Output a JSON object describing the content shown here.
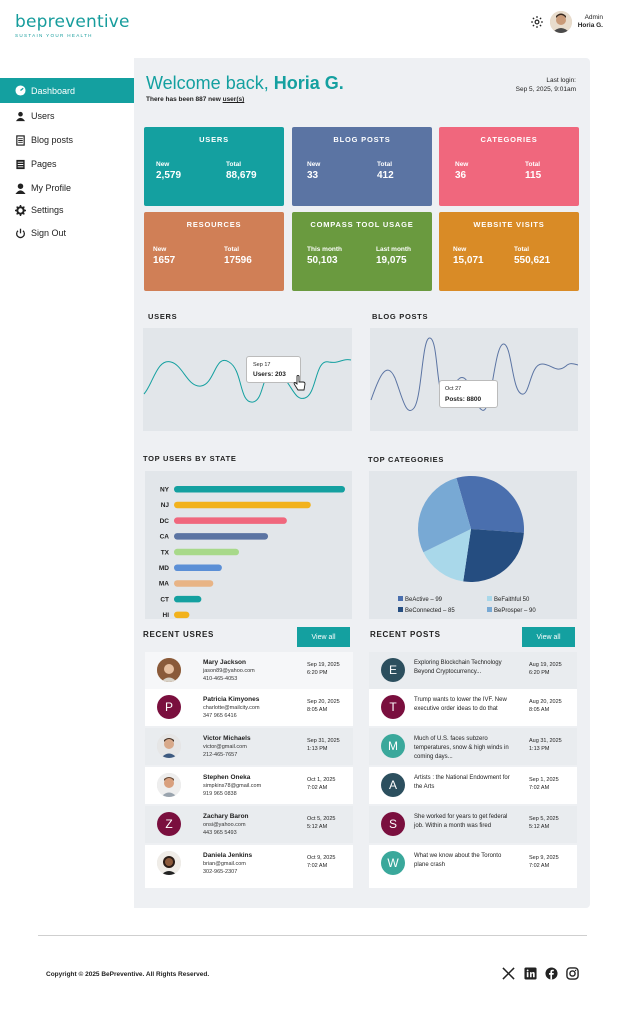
{
  "brand": {
    "name": "bepreventive",
    "tagline": "SUSTAIN YOUR HEALTH",
    "color": "#169c9c"
  },
  "header": {
    "admin_role": "Admin",
    "admin_name": "Horia G."
  },
  "sidebar": {
    "items": [
      {
        "label": "Dashboard",
        "icon": "dashboard-icon",
        "active": true
      },
      {
        "label": "Users",
        "icon": "users-icon"
      },
      {
        "label": "Blog posts",
        "icon": "blog-icon"
      },
      {
        "label": "Pages",
        "icon": "pages-icon"
      },
      {
        "label": "My Profile",
        "icon": "profile-icon"
      },
      {
        "label": "Settings",
        "icon": "gear-icon"
      },
      {
        "label": "Sign Out",
        "icon": "power-icon"
      }
    ]
  },
  "welcome": {
    "greeting": "Welcome back, ",
    "name": "Horia G.",
    "new_users_prefix": "There has been 887 new ",
    "new_users_link": "user(s)",
    "last_login_label": "Last login:",
    "last_login_value": "Sep 5, 2025, 9:01am"
  },
  "stats": [
    {
      "title": "USERS",
      "l1": "New",
      "v1": "2,579",
      "l2": "Total",
      "v2": "88,679",
      "color": "#14a0a0"
    },
    {
      "title": "BLOG POSTS",
      "l1": "New",
      "v1": "33",
      "l2": "Total",
      "v2": "412",
      "color": "#5b74a3"
    },
    {
      "title": "CATEGORIES",
      "l1": "New",
      "v1": "36",
      "l2": "Total",
      "v2": "115",
      "color": "#f0677d"
    },
    {
      "title": "RESOURCES",
      "l1": "New",
      "v1": "1657",
      "l2": "Total",
      "v2": "17596",
      "color": "#d07f56"
    },
    {
      "title": "COMPASS TOOL USAGE",
      "l1": "This month",
      "v1": "50,103",
      "l2": "Last month",
      "v2": "19,075",
      "color": "#6a9a3f"
    },
    {
      "title": "WEBSITE VISITS",
      "l1": "New",
      "v1": "15,071",
      "l2": "Total",
      "v2": "550,621",
      "color": "#d98b26"
    }
  ],
  "charts": {
    "users_title": "USERS",
    "users_tooltip_date": "Sep 17",
    "users_tooltip_value": "Users: 203",
    "blog_title": "BLOG POSTS",
    "blog_tooltip_date": "Oct 27",
    "blog_tooltip_value": "Posts: 8800",
    "states_title": "TOP USERS BY STATE",
    "categories_title": "TOP CATEGORIES"
  },
  "chart_data": [
    {
      "type": "bar",
      "title": "TOP USERS BY STATE",
      "orientation": "horizontal",
      "categories": [
        "NY",
        "NJ",
        "DC",
        "CA",
        "TX",
        "MD",
        "MA",
        "CT",
        "HI"
      ],
      "values": [
        100,
        80,
        66,
        55,
        38,
        28,
        23,
        16,
        9
      ],
      "colors": [
        "#14a0a0",
        "#f2b21c",
        "#f0677d",
        "#5b74a3",
        "#a8d98a",
        "#5b8fd6",
        "#e8b486",
        "#14a0a0",
        "#f2b21c"
      ]
    },
    {
      "type": "pie",
      "title": "TOP CATEGORIES",
      "labels": [
        "BeActive – 99",
        "BeFaithful   50",
        "BeConnected – 85",
        "BeProsper – 90"
      ],
      "values": [
        99,
        50,
        85,
        90
      ],
      "colors": [
        "#4a6fae",
        "#a9d8ea",
        "#254d80",
        "#78a9d4"
      ]
    }
  ],
  "recent_users": {
    "title": "RECENT USRES",
    "view_all": "View all",
    "rows": [
      {
        "initial": "",
        "avatar": "photo",
        "name": "Mary Jackson",
        "email": "jason89@yahoo.com",
        "phone": "410-465-4053",
        "date": "Sep 19, 2025",
        "time": "6:20 PM"
      },
      {
        "initial": "P",
        "avatar": "#7a0f3e",
        "name": "Patricia Kimyones",
        "email": "charlotte@mailcity.com",
        "phone": "347 965 6416",
        "date": "Sep 20, 2025",
        "time": "8:05 AM"
      },
      {
        "initial": "",
        "avatar": "photo",
        "name": "Victor Michaels",
        "email": "victor@gmail.com",
        "phone": "212-465-7657",
        "date": "Sep 31, 2025",
        "time": "1:13 PM"
      },
      {
        "initial": "",
        "avatar": "photo",
        "name": "Stephen Oneka",
        "email": "simpkins78@gmail.com",
        "phone": "919 965 0838",
        "date": "Oct 1, 2025",
        "time": "7:02 AM"
      },
      {
        "initial": "Z",
        "avatar": "#7a0f3e",
        "name": "Zachary Baron",
        "email": "onsi@yahoo.com",
        "phone": "443 965 5493",
        "date": "Oct 5, 2025",
        "time": "5:12 AM"
      },
      {
        "initial": "",
        "avatar": "photo",
        "name": "Daniela Jenkins",
        "email": "brian@gmail.com",
        "phone": "302-965-2307",
        "date": "Oct 9, 2025",
        "time": "7:02 AM"
      }
    ]
  },
  "recent_posts": {
    "title": "RECENT POSTS",
    "view_all": "View all",
    "rows": [
      {
        "initial": "E",
        "color": "#2c4f5e",
        "text": "Exploring Blockchain Technology Beyond Cryptocurrency...",
        "date": "Aug 19, 2025",
        "time": "6:20 PM"
      },
      {
        "initial": "T",
        "color": "#7a0f3e",
        "text": "Trump wants to lower the IVF. New executive order ideas to do that",
        "date": "Aug 20, 2025",
        "time": "8:05 AM"
      },
      {
        "initial": "M",
        "color": "#3aa89b",
        "text": "Much of U.S. faces subzero temperatures, snow & high winds in coming days...",
        "date": "Aug 31, 2025",
        "time": "1:13 PM"
      },
      {
        "initial": "A",
        "color": "#2c4f5e",
        "text": "Artists : the National Endowment for the Arts",
        "date": "Sep 1, 2025",
        "time": "7:02 AM"
      },
      {
        "initial": "S",
        "color": "#7a0f3e",
        "text": "She worked for years to get federal job. Within a month was fired",
        "date": "Sep 5, 2025",
        "time": "5:12 AM"
      },
      {
        "initial": "W",
        "color": "#3aa89b",
        "text": "What we know about the Toronto plane crash",
        "date": "Sep 9, 2025",
        "time": "7:02 AM"
      }
    ]
  },
  "footer": {
    "copyright": "Copyright © 2025 BePreventive. All Rights Reserved.",
    "social": [
      "x-icon",
      "linkedin-icon",
      "facebook-icon",
      "instagram-icon"
    ]
  }
}
